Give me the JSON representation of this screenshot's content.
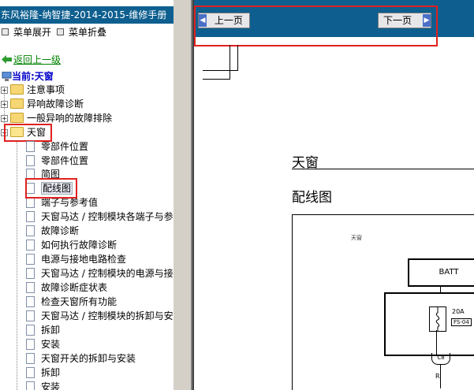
{
  "header": {
    "title": "东风裕隆-纳智捷-2014-2015-维修手册"
  },
  "menu_controls": {
    "expand": "菜单展开",
    "collapse": "菜单折叠"
  },
  "back_link": "返回上一级",
  "current": "当前:天窗",
  "tree": {
    "folders": [
      "注意事项",
      "异响故障诊断",
      "一般异响的故障排除"
    ],
    "open_folder": "天窗",
    "items": [
      "零部件位置",
      "零部件位置",
      "简图",
      "配线图",
      "端子与参考值",
      "天窗马达 / 控制模块各端子与参",
      "故障诊断",
      "如何执行故障诊断",
      "电源与接地电路检查",
      "天窗马达 / 控制模块的电源与接",
      "故障诊断症状表",
      "检查天窗所有功能",
      "天窗马达 / 控制模块的拆卸与安",
      "拆卸",
      "安装",
      "天窗开关的拆卸与安装",
      "拆卸",
      "安装"
    ],
    "selected_index": 3
  },
  "nav": {
    "prev": "上一页",
    "next": "下一页"
  },
  "content": {
    "section_title": "天窗",
    "sub_title": "配线图",
    "diagram": {
      "caption": "天窗",
      "batt_label": "BATT",
      "fuse_amp": "20A",
      "fuse_id": "FS-04",
      "connector": "C8",
      "wire": "R"
    }
  },
  "colors": {
    "bar_blue": "#0e5f8f",
    "highlight_red": "#e02020",
    "link_green": "#008000",
    "current_blue": "#0000cc"
  }
}
